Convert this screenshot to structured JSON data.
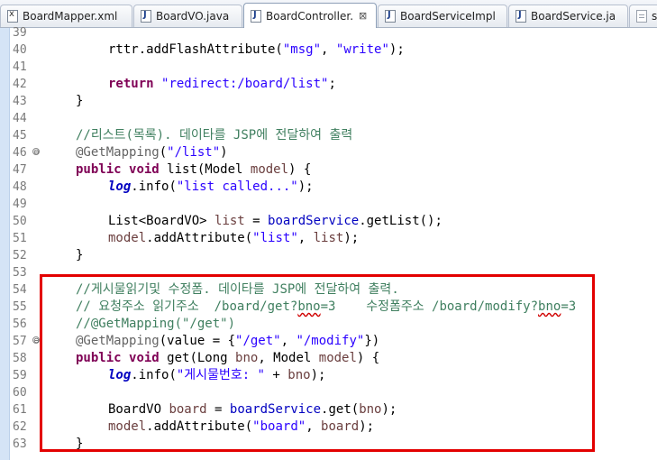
{
  "tabs": [
    {
      "label": "BoardMapper.xml",
      "icon": "xml-file-icon",
      "active": false
    },
    {
      "label": "BoardVO.java",
      "icon": "java-file-icon",
      "active": false
    },
    {
      "label": "BoardController.",
      "icon": "java-file-icon",
      "active": true,
      "close": "⊠"
    },
    {
      "label": "BoardServiceImpl",
      "icon": "java-file-icon",
      "active": false
    },
    {
      "label": "BoardService.ja",
      "icon": "java-file-icon",
      "active": false
    },
    {
      "label": "st",
      "icon": "text-file-icon",
      "active": false
    }
  ],
  "line_numbers": [
    "39",
    "40",
    "41",
    "42",
    "43",
    "44",
    "45",
    "46",
    "47",
    "48",
    "49",
    "50",
    "51",
    "52",
    "53",
    "54",
    "55",
    "56",
    "57",
    "58",
    "59",
    "60",
    "61",
    "62",
    "63"
  ],
  "fold_markers": {
    "46": "⊖",
    "57": "⊖"
  },
  "code": {
    "l40": {
      "a": "rttr.addFlashAttribute(",
      "b": "\"msg\"",
      "c": ", ",
      "d": "\"write\"",
      "e": ");"
    },
    "l42": {
      "kw": "return",
      "sp": " ",
      "str": "\"redirect:/board/list\"",
      "e": ";"
    },
    "l43": {
      "t": "}"
    },
    "l45": {
      "com": "//리스트(목록). 데이타를 JSP에 전달하여 출력"
    },
    "l46": {
      "ann": "@GetMapping",
      "a": "(",
      "str": "\"/list\"",
      "e": ")"
    },
    "l47": {
      "kw1": "public",
      "s1": " ",
      "kw2": "void",
      "a": " list(Model ",
      "var": "model",
      "e": ") {"
    },
    "l48": {
      "fld": "log",
      "a": ".info(",
      "str": "\"list called...\"",
      "e": ");"
    },
    "l50": {
      "a": "List<BoardVO> ",
      "var": "list",
      "b": " = ",
      "fld": "boardService",
      "e": ".getList();"
    },
    "l51": {
      "var": "model",
      "a": ".addAttribute(",
      "str": "\"list\"",
      "b": ", ",
      "var2": "list",
      "e": ");"
    },
    "l52": {
      "t": "}"
    },
    "l54": {
      "com": "//게시물읽기및 수정폼. 데이타를 JSP에 전달하여 출력."
    },
    "l55": {
      "a": "// 요청주소 읽기주소  /board/get?",
      "w1": "bno",
      "b": "=3    수정폼주소 /board/modify?",
      "w2": "bno",
      "c": "=3"
    },
    "l56": {
      "com": "//@GetMapping(\"/get\")"
    },
    "l57": {
      "ann": "@GetMapping",
      "a": "(value = {",
      "s1": "\"/get\"",
      "b": ", ",
      "s2": "\"/modify\"",
      "e": "})"
    },
    "l58": {
      "kw1": "public",
      "s1": " ",
      "kw2": "void",
      "a": " get(Long ",
      "v1": "bno",
      "b": ", Model ",
      "v2": "model",
      "e": ") {"
    },
    "l59": {
      "fld": "log",
      "a": ".info(",
      "str": "\"게시물번호: \"",
      "b": " + ",
      "var": "bno",
      "e": ");"
    },
    "l61": {
      "a": "BoardVO ",
      "var": "board",
      "b": " = ",
      "fld": "boardService",
      "c": ".get(",
      "var2": "bno",
      "e": ");"
    },
    "l62": {
      "var": "model",
      "a": ".addAttribute(",
      "str": "\"board\"",
      "b": ", ",
      "var2": "board",
      "e": ");"
    },
    "l63": {
      "t": "}"
    }
  },
  "colors": {
    "highlight_border": "#e30000",
    "keyword": "#7f0055",
    "string": "#2a00ff",
    "comment": "#3f7f5f",
    "annotation": "#646464",
    "field": "#0000c0"
  }
}
